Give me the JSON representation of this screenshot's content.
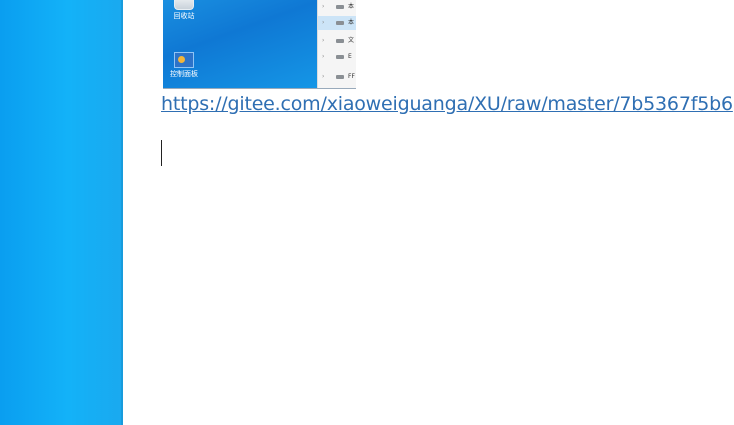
{
  "thumbnail": {
    "desktop_icons": [
      {
        "label": "回收站",
        "icon": "recycle-bin-icon"
      },
      {
        "label": "控制面板",
        "icon": "control-panel-icon"
      }
    ],
    "explorer_rows": [
      {
        "name": "本",
        "icon": "drive-icon",
        "selected": false
      },
      {
        "name": "本",
        "icon": "drive-icon",
        "selected": true
      },
      {
        "name": "文",
        "icon": "drive-icon",
        "selected": false
      },
      {
        "name": "E",
        "icon": "drive-icon",
        "selected": false
      },
      {
        "name": "FF",
        "icon": "drive-icon",
        "selected": false
      }
    ]
  },
  "editor": {
    "link_text": "https://gitee.com/xiaoweiguanga/XU/raw/master/7b5367f5b6"
  },
  "colors": {
    "desktop_blue": "#13b2f8",
    "link": "#2f6fb3",
    "background": "#ffffff"
  }
}
